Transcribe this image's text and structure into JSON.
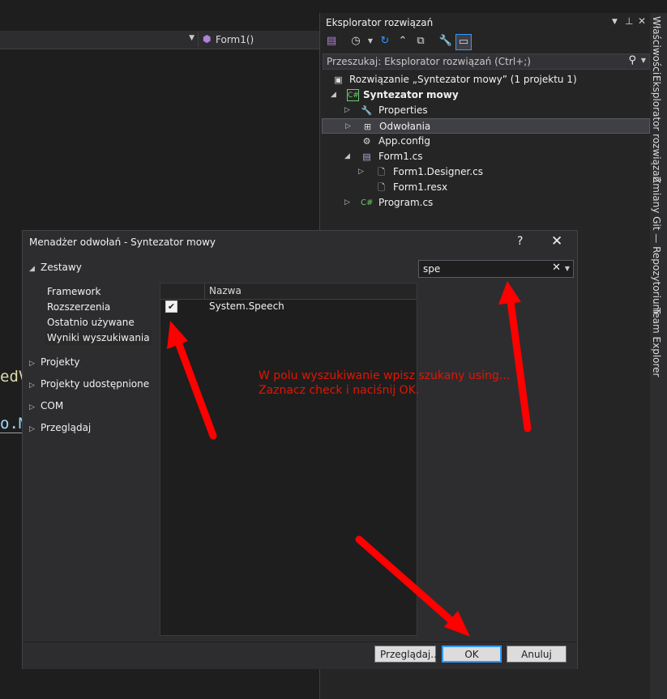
{
  "editor": {
    "nav_member": "Form1()",
    "code_fragment_1": "edV",
    "code_fragment_2": "o.M"
  },
  "solution_explorer": {
    "title": "Eksplorator rozwiązań",
    "search_placeholder": "Przeszukaj: Eksplorator rozwiązań (Ctrl+;)",
    "tree": {
      "solution": "Rozwiązanie „Syntezator mowy” (1 projektu 1)",
      "project": "Syntezator mowy",
      "properties": "Properties",
      "references": "Odwołania",
      "app_config": "App.config",
      "form1": "Form1.cs",
      "form1_designer": "Form1.Designer.cs",
      "form1_resx": "Form1.resx",
      "program": "Program.cs"
    }
  },
  "tool_tabs": [
    "Właściwości",
    "Eksplorator rozwiązań",
    "Zmiany Git — Repozytorium",
    "Team Explorer"
  ],
  "dialog": {
    "title": "Menadżer odwołań - Syntezator mowy",
    "help": "?",
    "nav": {
      "assemblies": "Zestawy",
      "framework": "Framework",
      "extensions": "Rozszerzenia",
      "recent": "Ostatnio używane",
      "search_results": "Wyniki wyszukiwania",
      "projects": "Projekty",
      "shared_projects": "Projekty udostępnione",
      "com": "COM",
      "browse": "Przeglądaj"
    },
    "search_value": "spe",
    "list": {
      "column_name": "Nazwa",
      "rows": [
        {
          "checked": true,
          "name": "System.Speech"
        }
      ]
    },
    "buttons": {
      "browse": "Przeglądaj...",
      "ok": "OK",
      "cancel": "Anuluj"
    }
  },
  "annotation": {
    "line1": "W polu wyszukiwanie wpisz szukany using...",
    "line2": "Zaznacz check i naciśnij OK.",
    "color": "#e51400"
  },
  "colors": {
    "background": "#1e1e1e",
    "panel": "#252526",
    "accent": "#3399ff",
    "annotation_red": "#e51400"
  }
}
